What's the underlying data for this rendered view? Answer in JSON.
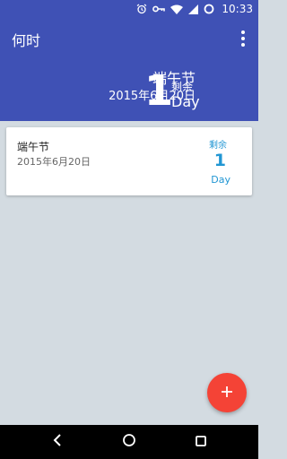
{
  "status_bar": {
    "time": "10:33"
  },
  "app_bar": {
    "title": "何时"
  },
  "hero": {
    "event_name": "端午节",
    "date": "2015年6月20日",
    "count": "1",
    "remain_label": "剩余",
    "unit": "Day"
  },
  "events": [
    {
      "title": "端午节",
      "date": "2015年6月20日",
      "remain_label": "剩余",
      "count": "1",
      "unit": "Day"
    }
  ],
  "colors": {
    "primary": "#3f51b5",
    "accent": "#f44336",
    "count_blue": "#2196d3",
    "background": "#d3dbe1"
  },
  "icons": {
    "alarm": "alarm-icon",
    "key": "key-icon",
    "wifi": "wifi-icon",
    "signal": "signal-icon",
    "battery": "battery-icon",
    "overflow": "more-vert-icon",
    "fab": "add-icon",
    "back": "back-icon",
    "home": "home-icon",
    "recents": "recents-icon"
  }
}
